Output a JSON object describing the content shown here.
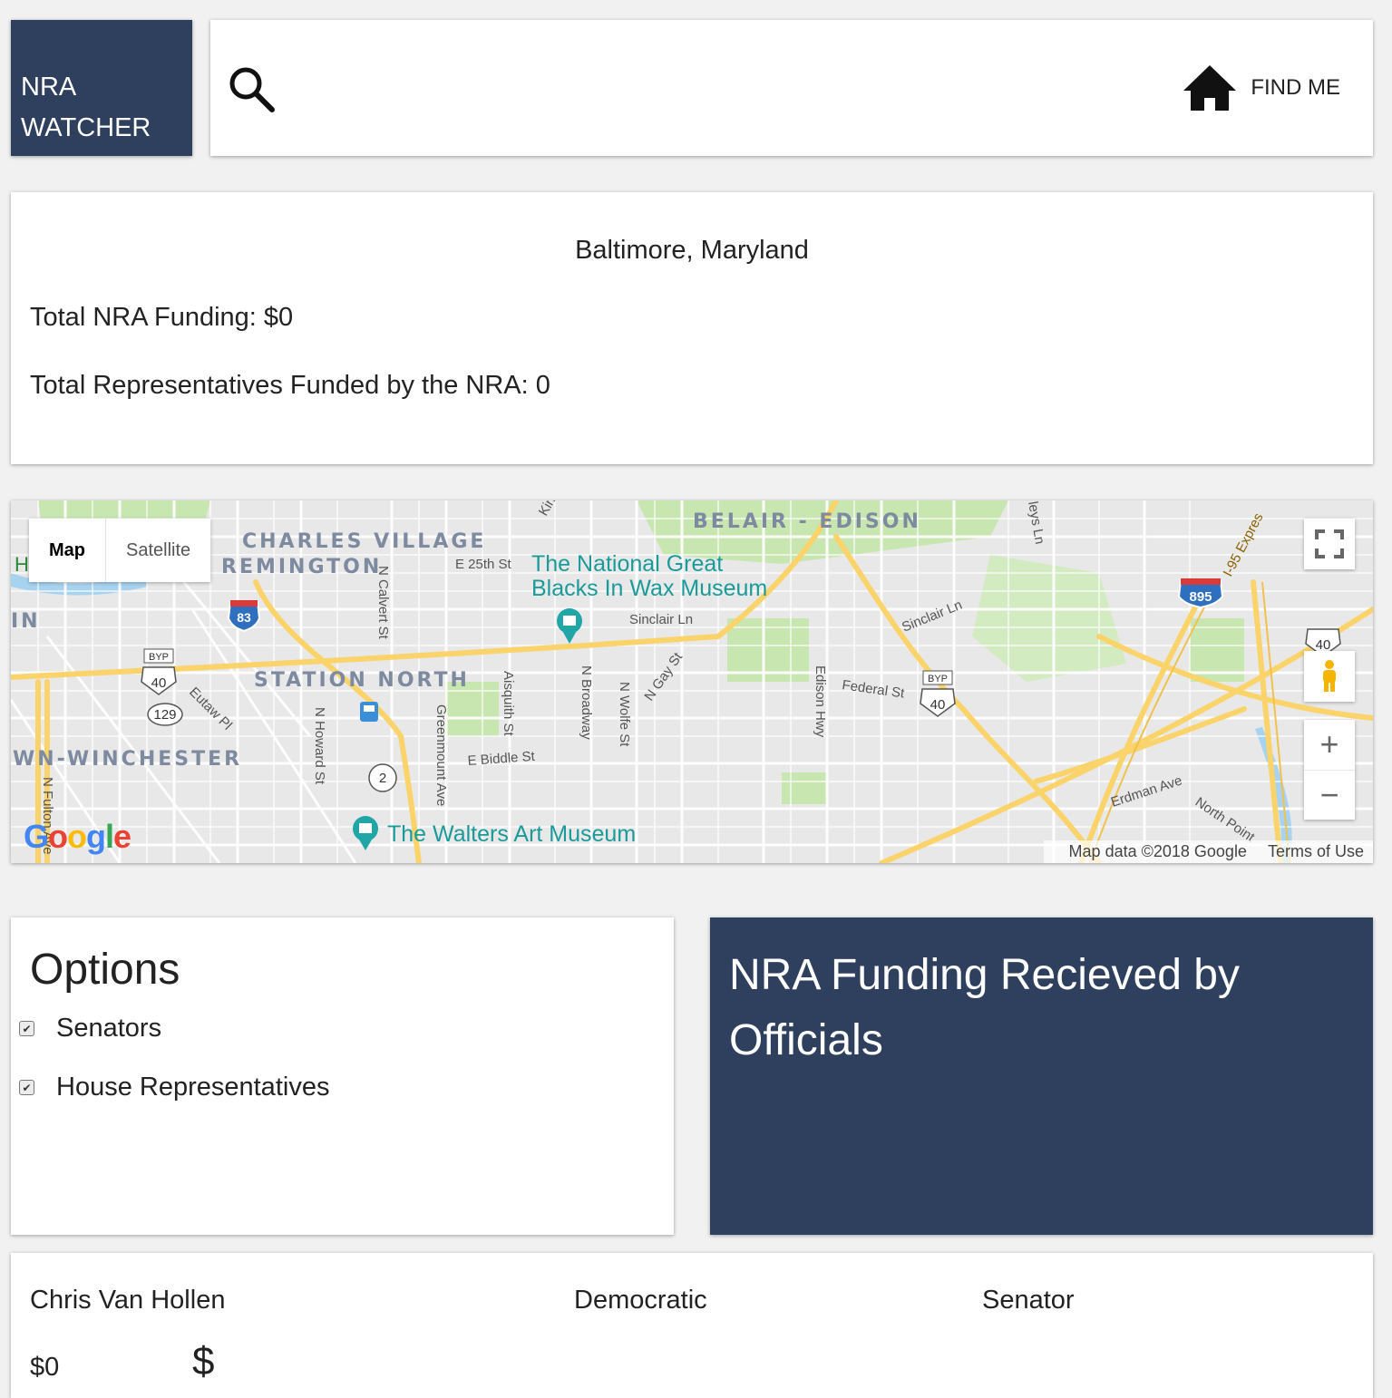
{
  "brand": {
    "line1": "NRA",
    "line2": "WATCHER"
  },
  "search": {
    "placeholder": "",
    "value": ""
  },
  "find_me": {
    "label": "FIND ME",
    "icon": "home-icon"
  },
  "summary": {
    "location": "Baltimore, Maryland",
    "total_funding": "Total NRA Funding: $0",
    "total_reps": "Total Representatives Funded by the NRA: 0"
  },
  "map": {
    "tabs": {
      "map": "Map",
      "satellite": "Satellite"
    },
    "labels": {
      "charles_village": "CHARLES VILLAGE",
      "remington": "REMINGTON",
      "belair": "BELAIR - EDISON",
      "station_north": "STATION NORTH",
      "winchester": "WN-WINCHESTER",
      "in": "IN",
      "h": "H",
      "wax_museum_1": "The National Great",
      "wax_museum_2": "Blacks In Wax Museum",
      "walters": "The Walters Art Museum",
      "e25": "E 25th St",
      "sinclair1": "Sinclair Ln",
      "sinclair2": "Sinclair Ln",
      "federal": "Federal St",
      "e_biddle": "E Biddle St",
      "erdman": "Erdman Ave",
      "north_point": "North Point",
      "i95": "I-95 Expres",
      "n_calvert": "N Calvert St",
      "n_howard": "N Howard St",
      "greenmount": "Greenmount Ave",
      "aisquith": "Aisquith St",
      "n_broadway": "N Broadway",
      "n_wolfe": "N Wolfe St",
      "n_gay": "N Gay St",
      "edison_hwy": "Edison Hwy",
      "eutaw": "Eutaw Pl",
      "n_fulton": "N Fulton Ave",
      "kirk": "Kirk",
      "leys": "leys Ln",
      "shield_83": "83",
      "shield_895": "895",
      "shield_40a": "40",
      "shield_40b": "40",
      "shield_40c": "40",
      "shield_129": "129",
      "shield_2": "2",
      "byp": "BYP"
    },
    "google": "Google",
    "footer": {
      "data": "Map data ©2018 Google",
      "terms": "Terms of Use"
    },
    "colors": {
      "highway": "#fad36a",
      "park": "#c8e6b0",
      "water": "#a8d3f0",
      "land": "#e8e8e8",
      "street": "#ffffff",
      "poi": "#20a6a6"
    }
  },
  "options": {
    "title": "Options",
    "items": [
      {
        "label": "Senators",
        "checked": true
      },
      {
        "label": "House Representatives",
        "checked": true
      }
    ]
  },
  "funding": {
    "title": "NRA Funding Recieved by Officials"
  },
  "officials": [
    {
      "name": "Chris Van Hollen",
      "party": "Democratic",
      "role": "Senator",
      "amount": "$0",
      "icon": "dollar-icon"
    }
  ]
}
